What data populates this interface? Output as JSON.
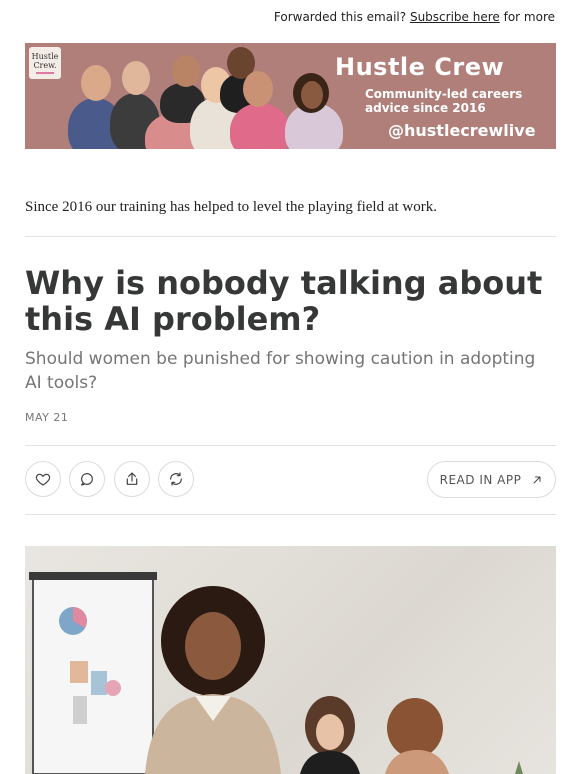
{
  "top": {
    "prefix": "Forwarded this email?",
    "subscribe_link": "Subscribe here",
    "suffix": "for more"
  },
  "banner": {
    "logo_text_1": "Hustle",
    "logo_text_2": "Crew.",
    "title": "Hustle Crew",
    "subtitle_line1": "Community-led careers",
    "subtitle_line2": "advice since 2016",
    "handle": "@hustlecrewlive"
  },
  "intro": "Since 2016 our training has helped to level the playing field at work.",
  "post": {
    "title": "Why is nobody talking about this AI problem?",
    "subtitle": "Should women be punished for showing caution in adopting AI tools?",
    "date": "MAY 21"
  },
  "actions": {
    "read_in_app": "READ IN APP"
  },
  "colors": {
    "banner_bg": "#b07f7a",
    "title_text": "#363737",
    "subtitle_text": "#757575"
  },
  "icons": [
    "heart-icon",
    "comment-icon",
    "share-icon",
    "restack-icon",
    "arrow-up-right-icon"
  ]
}
